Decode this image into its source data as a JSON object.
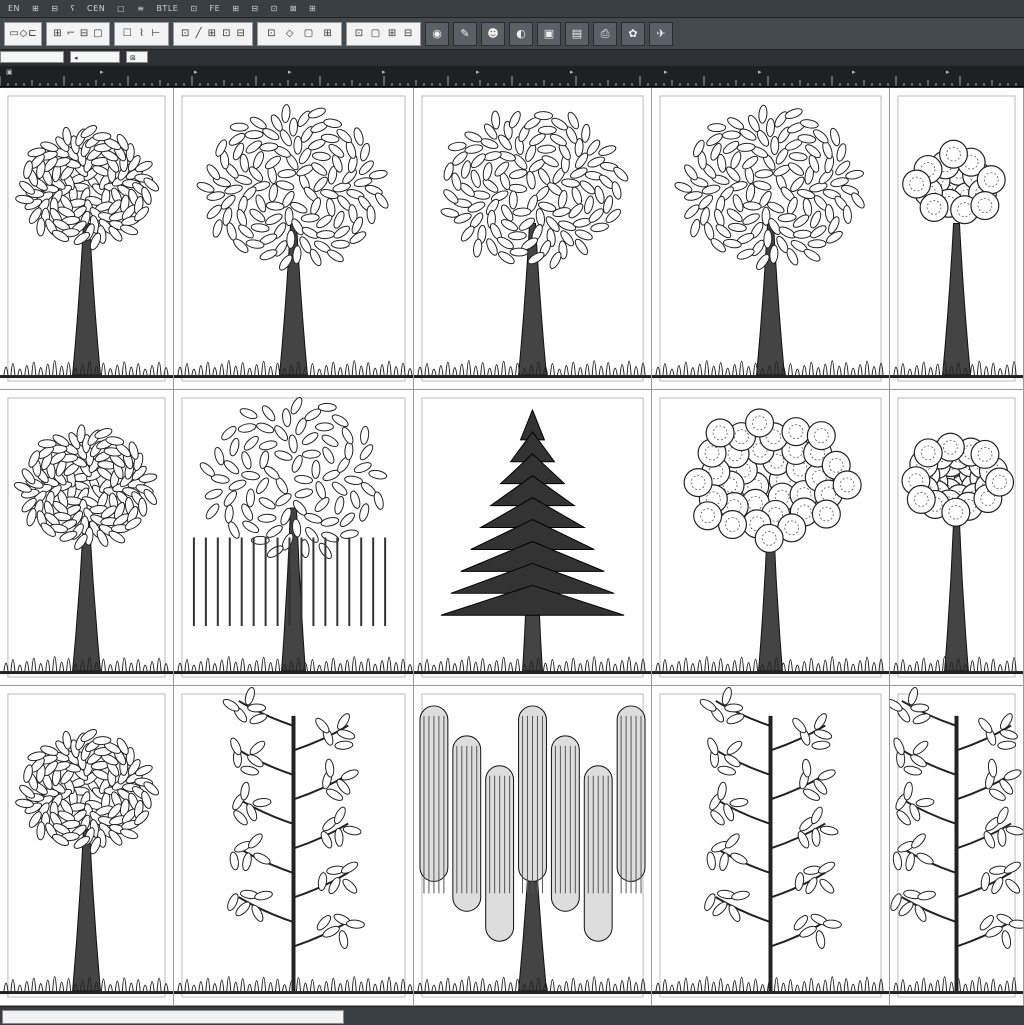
{
  "menubar": {
    "items": [
      "EN",
      "⊞",
      "⊟",
      "ʕ",
      "CEN",
      "▢",
      "≡",
      "BTLE",
      "⊡",
      "FE",
      "⊞",
      "⊟",
      "⊡",
      "⊠",
      "⊞"
    ]
  },
  "toolbar": {
    "groups": [
      {
        "name": "tool-group-1",
        "glyphs": [
          "▭",
          "◇",
          "⊏"
        ]
      },
      {
        "name": "tool-group-2",
        "glyphs": [
          "⊞",
          "⌐",
          "⊟",
          "▢"
        ]
      },
      {
        "name": "tool-group-3",
        "glyphs": [
          "☐",
          "⌇",
          "⊢"
        ]
      },
      {
        "name": "tool-group-4",
        "glyphs": [
          "⊡",
          "╱",
          "⊞",
          "⊡",
          "⊟"
        ]
      },
      {
        "name": "tool-group-5",
        "glyphs": [
          "⊡",
          "◇",
          "▢",
          "⊞"
        ]
      },
      {
        "name": "tool-group-6",
        "glyphs": [
          "⊡",
          "▢",
          "⊞",
          "⊟"
        ]
      }
    ],
    "buttons": [
      "◉",
      "✎",
      "☻",
      "◐",
      "▣",
      "▤",
      "⎙",
      "✿",
      "✈"
    ]
  },
  "addressbar": {
    "field1": "",
    "field2": "◂",
    "field3": "⊠"
  },
  "ruler": {
    "labels": [
      "▣",
      "▸",
      "▸",
      "▸",
      "▸",
      "▸",
      "▸",
      "▸",
      "▸",
      "▸",
      "▸"
    ]
  },
  "gallery": {
    "tiles": [
      {
        "icon": "tall-tree-icon"
      },
      {
        "icon": "leafy-tree-icon"
      },
      {
        "icon": "leaf-crown-tree-icon"
      },
      {
        "icon": "dense-tree-icon"
      },
      {
        "icon": "bonsai-tree-icon"
      },
      {
        "icon": "leafy-tree-icon"
      },
      {
        "icon": "weeping-tree-icon"
      },
      {
        "icon": "pine-tree-icon"
      },
      {
        "icon": "round-tree-icon"
      },
      {
        "icon": "round-tree-icon"
      },
      {
        "icon": "bush-tree-icon"
      },
      {
        "icon": "branch-tree-icon"
      },
      {
        "icon": "willow-tree-icon"
      },
      {
        "icon": "slender-tree-icon"
      },
      {
        "icon": "branch-tree-icon"
      }
    ]
  },
  "colors": {
    "chrome": "#3a3f44",
    "canvas": "#d9d9d9",
    "ink": "#222222"
  }
}
